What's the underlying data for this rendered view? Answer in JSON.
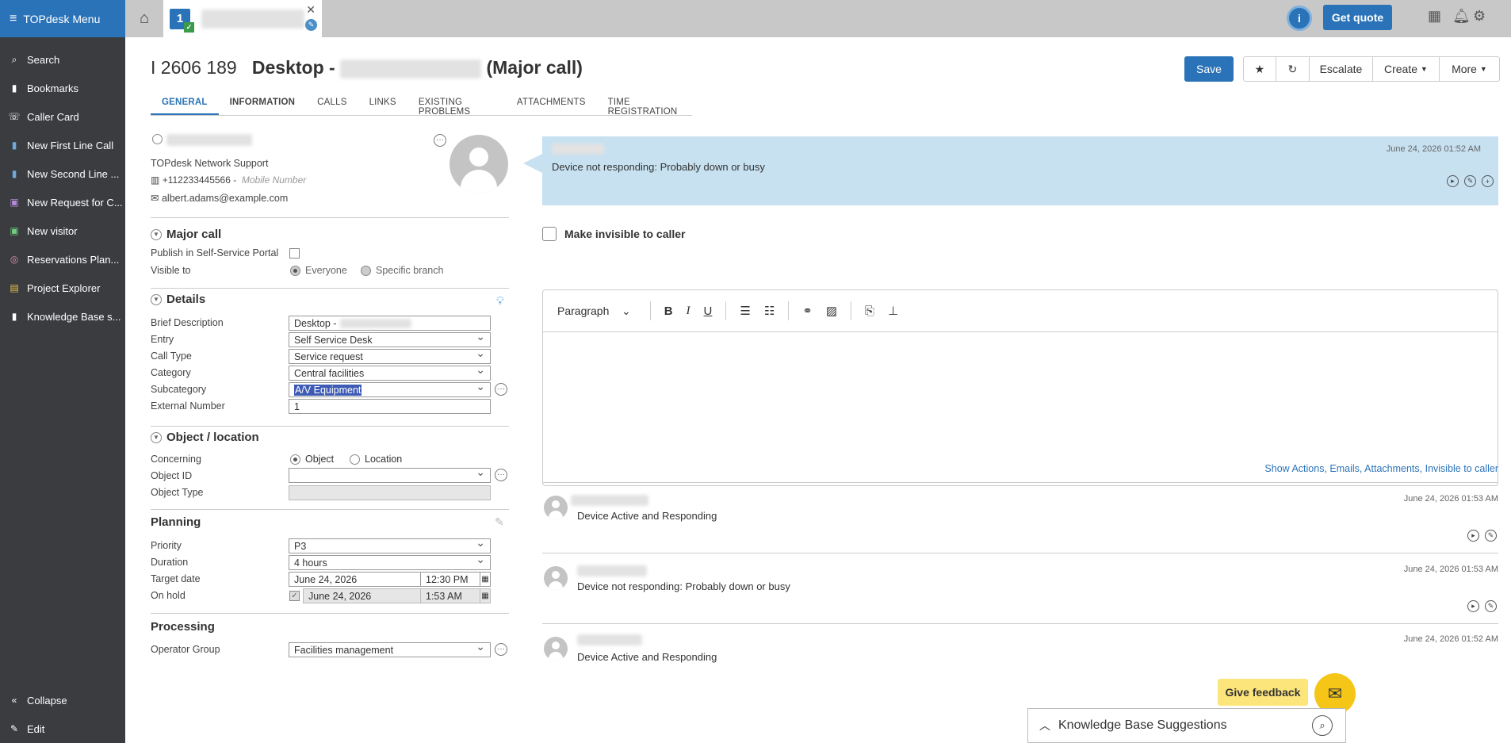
{
  "sidebar": {
    "menu_title": "TOPdesk Menu",
    "items": [
      {
        "label": "Search",
        "icon": "search-icon"
      },
      {
        "label": "Bookmarks",
        "icon": "bookmark-icon"
      },
      {
        "label": "Caller Card",
        "icon": "phone-icon"
      },
      {
        "label": "New First Line Call",
        "icon": "first-line-call-icon"
      },
      {
        "label": "New Second Line ...",
        "icon": "second-line-call-icon"
      },
      {
        "label": "New Request for C...",
        "icon": "request-for-change-icon"
      },
      {
        "label": "New visitor",
        "icon": "visitor-icon"
      },
      {
        "label": "Reservations Plan...",
        "icon": "reservations-icon"
      },
      {
        "label": "Project Explorer",
        "icon": "project-icon"
      },
      {
        "label": "Knowledge Base s...",
        "icon": "knowledge-base-icon"
      }
    ],
    "collapse": "Collapse",
    "edit": "Edit"
  },
  "topbar": {
    "tab_icon_number": "1",
    "get_quote": "Get quote",
    "info": "i"
  },
  "header": {
    "number": "I 2606 189",
    "title_prefix": "Desktop -",
    "title_suffix": "(Major call)",
    "save": "Save",
    "escalate": "Escalate",
    "create": "Create",
    "more": "More"
  },
  "tabs": [
    "GENERAL",
    "INFORMATION",
    "CALLS",
    "LINKS",
    "EXISTING PROBLEMS",
    "ATTACHMENTS",
    "TIME REGISTRATION"
  ],
  "caller": {
    "branch": "TOPdesk Network Support",
    "phone": "+112233445566",
    "mobile_placeholder": "Mobile Number",
    "email": "albert.adams@example.com"
  },
  "major_call": {
    "heading": "Major call",
    "publish_label": "Publish in Self-Service Portal",
    "visible_label": "Visible to",
    "everyone": "Everyone",
    "specific_branch": "Specific branch"
  },
  "details": {
    "heading": "Details",
    "brief_description_label": "Brief Description",
    "brief_description": "Desktop -",
    "entry_label": "Entry",
    "entry": "Self Service Desk",
    "call_type_label": "Call Type",
    "call_type": "Service request",
    "category_label": "Category",
    "category": "Central facilities",
    "subcategory_label": "Subcategory",
    "subcategory": "A/V Equipment",
    "external_number_label": "External Number",
    "external_number": "1"
  },
  "object_location": {
    "heading": "Object / location",
    "concerning_label": "Concerning",
    "object": "Object",
    "location": "Location",
    "object_id_label": "Object ID",
    "object_type_label": "Object Type"
  },
  "planning": {
    "heading": "Planning",
    "priority_label": "Priority",
    "priority": "P3",
    "duration_label": "Duration",
    "duration": "4 hours",
    "target_date_label": "Target date",
    "target_date": "June 24, 2026",
    "target_time": "12:30 PM",
    "on_hold_label": "On hold",
    "on_hold_date": "June 24, 2026",
    "on_hold_time": "1:53 AM"
  },
  "processing": {
    "heading": "Processing",
    "operator_group_label": "Operator Group",
    "operator_group": "Facilities management"
  },
  "conversation": {
    "top_message": {
      "timestamp": "June 24, 2026 01:52 AM",
      "text": "Device not responding: Probably down or busy"
    },
    "invisible_label": "Make invisible to caller",
    "paragraph": "Paragraph",
    "show_actions_link": "Show Actions, Emails, Attachments, Invisible to caller",
    "entries": [
      {
        "timestamp": "June 24, 2026 01:53 AM",
        "text": "Device Active and Responding"
      },
      {
        "timestamp": "June 24, 2026 01:53 AM",
        "text": "Device not responding: Probably down or busy"
      },
      {
        "timestamp": "June 24, 2026 01:52 AM",
        "text": "Device Active and Responding"
      }
    ]
  },
  "feedback": "Give feedback",
  "kb_suggestions": "Knowledge Base Suggestions"
}
